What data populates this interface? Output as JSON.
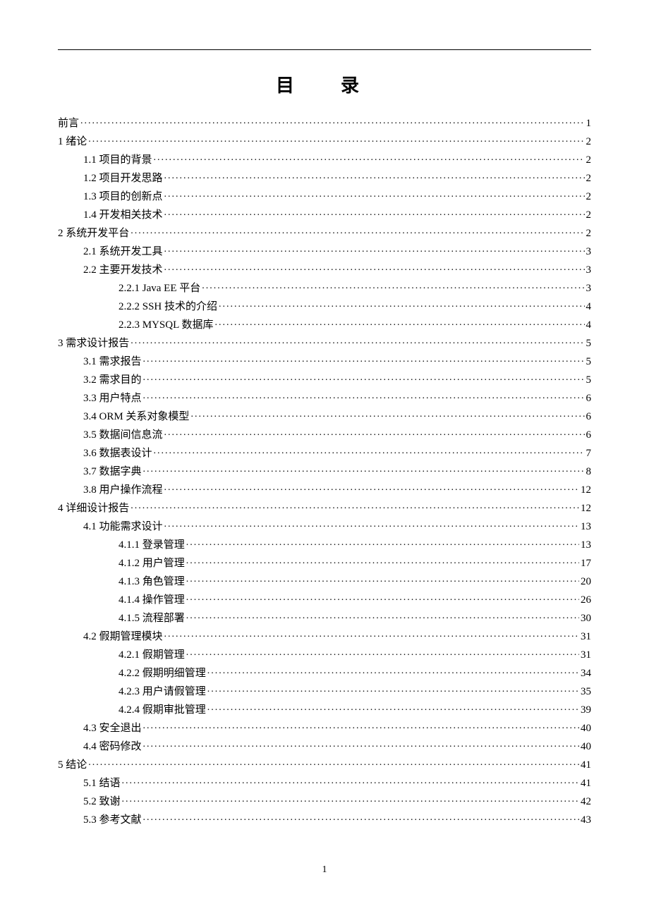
{
  "title": "目　录",
  "page_number": "1",
  "toc": [
    {
      "level": 0,
      "label": "前言",
      "page": "1"
    },
    {
      "level": 0,
      "label": "1 绪论",
      "page": "2"
    },
    {
      "level": 1,
      "label": "1.1 项目的背景",
      "page": "2"
    },
    {
      "level": 1,
      "label": "1.2 项目开发思路",
      "page": "2"
    },
    {
      "level": 1,
      "label": "1.3 项目的创新点",
      "page": "2"
    },
    {
      "level": 1,
      "label": "1.4 开发相关技术",
      "page": "2"
    },
    {
      "level": 0,
      "label": "2 系统开发平台",
      "page": "2"
    },
    {
      "level": 1,
      "label": "2.1 系统开发工具",
      "page": "3"
    },
    {
      "level": 1,
      "label": "2.2 主要开发技术",
      "page": "3"
    },
    {
      "level": 2,
      "label": "2.2.1 Java EE 平台",
      "page": "3"
    },
    {
      "level": 2,
      "label": "2.2.2 SSH 技术的介绍",
      "page": "4"
    },
    {
      "level": 2,
      "label": "2.2.3 MYSQL 数据库",
      "page": "4"
    },
    {
      "level": 0,
      "label": "3 需求设计报告",
      "page": "5"
    },
    {
      "level": 1,
      "label": "3.1 需求报告",
      "page": "5"
    },
    {
      "level": 1,
      "label": "3.2 需求目的",
      "page": "5"
    },
    {
      "level": 1,
      "label": "3.3 用户特点",
      "page": "6"
    },
    {
      "level": 1,
      "label": "3.4 ORM 关系对象模型",
      "page": "6"
    },
    {
      "level": 1,
      "label": "3.5 数据间信息流",
      "page": "6"
    },
    {
      "level": 1,
      "label": "3.6 数据表设计",
      "page": "7"
    },
    {
      "level": 1,
      "label": "3.7 数据字典",
      "page": "8"
    },
    {
      "level": 1,
      "label": "3.8 用户操作流程",
      "page": "12"
    },
    {
      "level": 0,
      "label": "4 详细设计报告",
      "page": "12"
    },
    {
      "level": 1,
      "label": "4.1 功能需求设计",
      "page": "13"
    },
    {
      "level": 2,
      "label": "4.1.1 登录管理",
      "page": "13"
    },
    {
      "level": 2,
      "label": "4.1.2 用户管理",
      "page": "17"
    },
    {
      "level": 2,
      "label": "4.1.3 角色管理",
      "page": "20"
    },
    {
      "level": 2,
      "label": "4.1.4 操作管理",
      "page": "26"
    },
    {
      "level": 2,
      "label": "4.1.5 流程部署",
      "page": "30"
    },
    {
      "level": 1,
      "label": "4.2 假期管理模块",
      "page": "31"
    },
    {
      "level": 2,
      "label": "4.2.1 假期管理",
      "page": "31"
    },
    {
      "level": 2,
      "label": "4.2.2 假期明细管理",
      "page": "34"
    },
    {
      "level": 2,
      "label": "4.2.3 用户请假管理",
      "page": "35"
    },
    {
      "level": 2,
      "label": "4.2.4 假期审批管理",
      "page": "39"
    },
    {
      "level": 1,
      "label": "4.3 安全退出",
      "page": "40"
    },
    {
      "level": 1,
      "label": "4.4 密码修改",
      "page": "40"
    },
    {
      "level": 0,
      "label": "5 结论",
      "page": "41"
    },
    {
      "level": 1,
      "label": "5.1 结语",
      "page": "41"
    },
    {
      "level": 1,
      "label": "5.2 致谢",
      "page": "42"
    },
    {
      "level": 1,
      "label": "5.3 参考文献",
      "page": "43"
    }
  ]
}
